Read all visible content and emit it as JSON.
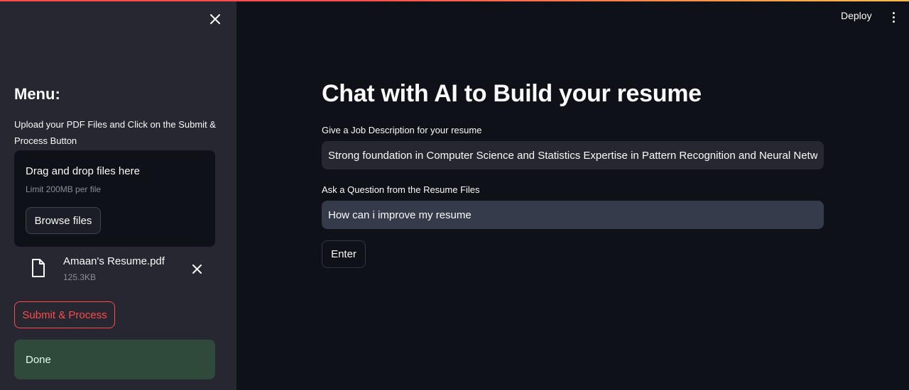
{
  "header": {
    "deploy_label": "Deploy",
    "menu_icon": "kebab-menu-icon"
  },
  "sidebar": {
    "close_icon": "close-icon",
    "menu_title": "Menu:",
    "upload_help": "Upload your PDF Files and Click on the Submit & Process Button",
    "dropzone": {
      "title": "Drag and drop files here",
      "limit": "Limit 200MB per file",
      "browse_label": "Browse files"
    },
    "file": {
      "icon": "file-icon",
      "name": "Amaan's Resume.pdf",
      "size": "125.3KB",
      "remove_icon": "close-icon"
    },
    "submit_label": "Submit & Process",
    "status_text": "Done"
  },
  "main": {
    "title": "Chat with AI to Build your resume",
    "job_description": {
      "label": "Give a Job Description for your resume",
      "value": "Strong foundation in Computer Science and Statistics Expertise in Pattern Recognition and Neural Networks"
    },
    "question": {
      "label": "Ask a Question from the Resume Files",
      "value": "How can i improve my resume"
    },
    "enter_label": "Enter"
  },
  "colors": {
    "app_background": "#0e1117",
    "sidebar_background": "#262730",
    "accent": "#ff4b4b",
    "success_background": "#2f4a3a"
  }
}
